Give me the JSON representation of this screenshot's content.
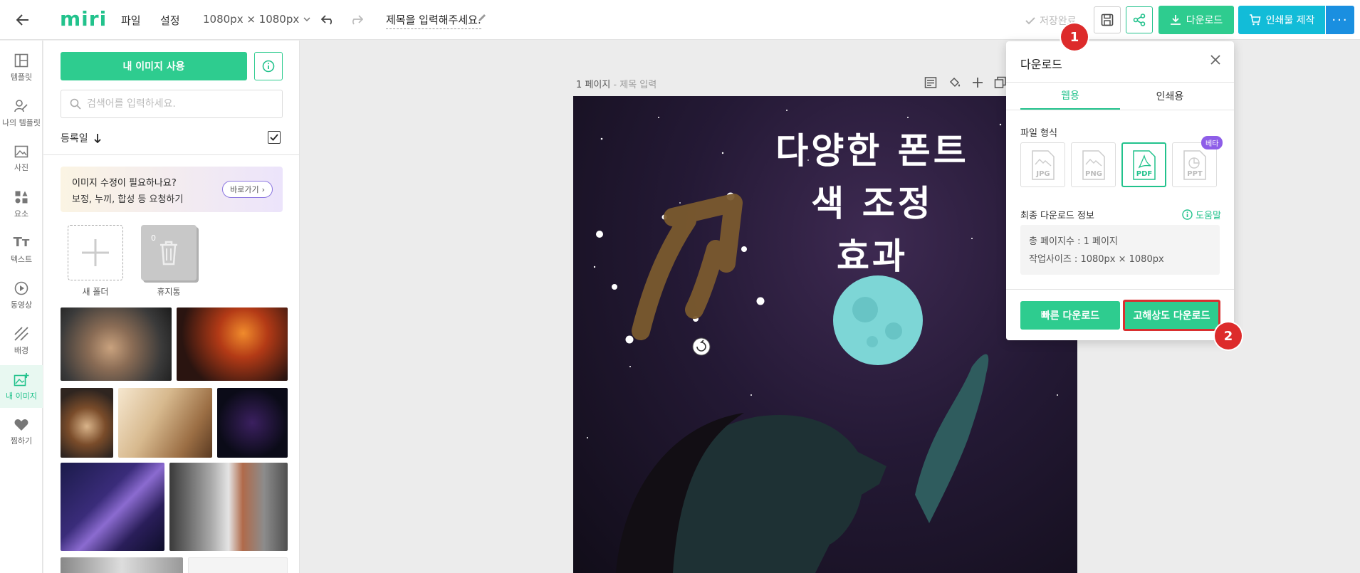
{
  "topbar": {
    "logo": "miri",
    "menu": [
      "파일",
      "설정"
    ],
    "canvas_size": "1080px × 1080px",
    "title": "제목을 입력해주세요.",
    "save_status": "저장완료",
    "download_label": "다운로드",
    "print_label": "인쇄물 제작",
    "more_label": "···"
  },
  "rail": [
    {
      "label": "템플릿",
      "icon": "template-icon"
    },
    {
      "label": "나의 템플릿",
      "icon": "my-template-icon"
    },
    {
      "label": "사진",
      "icon": "photo-icon"
    },
    {
      "label": "요소",
      "icon": "elements-icon"
    },
    {
      "label": "텍스트",
      "icon": "text-icon"
    },
    {
      "label": "동영상",
      "icon": "video-icon"
    },
    {
      "label": "배경",
      "icon": "background-icon"
    },
    {
      "label": "내 이미지",
      "icon": "my-image-icon",
      "active": true
    },
    {
      "label": "찜하기",
      "icon": "heart-icon"
    }
  ],
  "panel": {
    "use_image_label": "내 이미지 사용",
    "search_placeholder": "검색어를 입력하세요.",
    "sort_label": "등록일",
    "promo_title": "이미지 수정이 필요하나요?",
    "promo_sub": "보정, 누끼, 합성 등 요청하기",
    "promo_button": "바로가기",
    "new_folder_label": "새 폴더",
    "trash_label": "휴지통",
    "trash_count": "0"
  },
  "canvas": {
    "page_label": "1 페이지",
    "page_sub": " - 제목 입력",
    "text_lines": [
      "다양한 폰트",
      "색 조정",
      "효과"
    ]
  },
  "download_panel": {
    "title": "다운로드",
    "tabs": [
      "웹용",
      "인쇄용"
    ],
    "file_format_label": "파일 형식",
    "formats": [
      "JPG",
      "PNG",
      "PDF",
      "PPT"
    ],
    "selected_format": "PDF",
    "beta_label": "베타",
    "final_info_label": "최종 다운로드 정보",
    "help_label": "도움말",
    "total_pages": "총 페이지수 : 1 페이지",
    "work_size": "작업사이즈 : 1080px × 1080px",
    "quick_download": "빠른 다운로드",
    "hires_download": "고해상도 다운로드"
  },
  "annotations": [
    "1",
    "2"
  ],
  "colors": {
    "accent": "#2ecc8f",
    "print": "#12bcd8",
    "more": "#1a8fe0",
    "badge": "#dd2b2b",
    "beta": "#8e5ee8"
  }
}
